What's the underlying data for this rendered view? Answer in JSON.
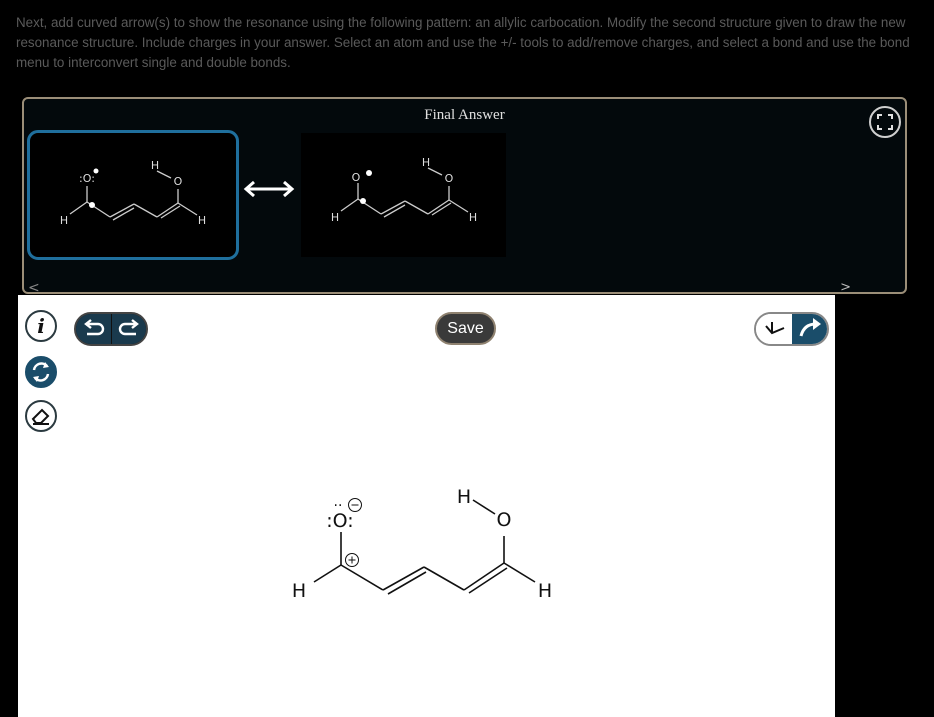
{
  "instructions": "Next, add curved arrow(s) to show the resonance using the following pattern: an allylic carbocation. Modify the second structure given to draw the new resonance structure. Include charges in your answer. Select an atom and use the +/- tools to add/remove charges, and select a bond and use the bond menu to interconvert single and double bonds.",
  "answer_panel": {
    "title": "Final Answer",
    "nav_prev": "<",
    "nav_next": ">"
  },
  "structure1": {
    "atoms": {
      "o_top": ":O:",
      "h_top": "H",
      "o_right": "O",
      "h_left": "H",
      "h_right": "H"
    }
  },
  "structure2": {
    "atoms": {
      "o_top": "O",
      "h_top": "H",
      "o_right": "O",
      "h_left": "H",
      "h_right": "H"
    }
  },
  "toolbar": {
    "save_label": "Save",
    "info_label": "i"
  },
  "main_structure": {
    "atoms": {
      "o_top": ":O:",
      "h_top": "H",
      "o_right": "O",
      "h_left": "H",
      "h_right": "H"
    },
    "charges": {
      "o_top": "negative",
      "carbon": "positive"
    }
  },
  "colors": {
    "accent": "#1f6f9d",
    "panel_border": "#9b8e78",
    "dark_button": "#1a4d6a"
  }
}
